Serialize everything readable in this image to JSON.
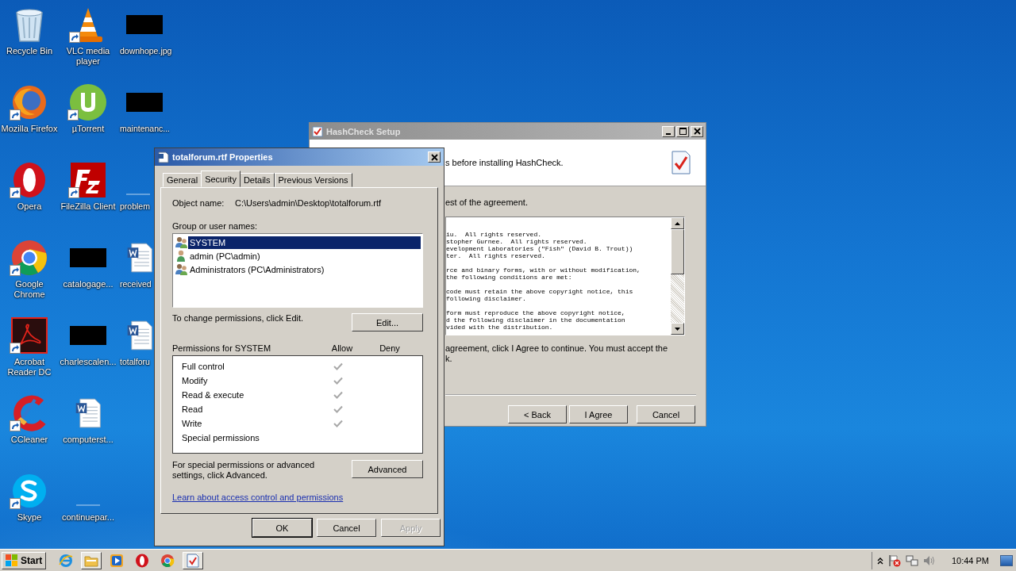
{
  "desktop_columns": [
    [
      {
        "label": "Recycle Bin",
        "kind": "recycle",
        "shortcut": false
      },
      {
        "label": "Mozilla Firefox",
        "kind": "firefox",
        "shortcut": true
      },
      {
        "label": "Opera",
        "kind": "opera",
        "shortcut": true
      },
      {
        "label": "Google Chrome",
        "kind": "chrome",
        "shortcut": true
      },
      {
        "label": "Acrobat Reader DC",
        "kind": "acrobat",
        "shortcut": true
      },
      {
        "label": "CCleaner",
        "kind": "ccleaner",
        "shortcut": true
      },
      {
        "label": "Skype",
        "kind": "skype",
        "shortcut": true
      }
    ],
    [
      {
        "label": "VLC media player",
        "kind": "vlc",
        "shortcut": true
      },
      {
        "label": "µTorrent",
        "kind": "utorrent",
        "shortcut": true
      },
      {
        "label": "FileZilla Client",
        "kind": "filezilla",
        "shortcut": true
      },
      {
        "label": "catalogage...",
        "kind": "redacted",
        "shortcut": false
      },
      {
        "label": "charlescalen...",
        "kind": "redacted",
        "shortcut": false
      },
      {
        "label": "computerst...",
        "kind": "word",
        "shortcut": false
      },
      {
        "label": "continuepar...",
        "kind": "blank",
        "shortcut": false
      }
    ],
    [
      {
        "label": "downhope.jpg",
        "kind": "redacted",
        "shortcut": false
      },
      {
        "label": "maintenanc...",
        "kind": "redacted",
        "shortcut": false
      },
      {
        "label": "problem",
        "kind": "blank",
        "shortcut": false
      },
      {
        "label": "received",
        "kind": "word",
        "shortcut": false
      },
      {
        "label": "totalforu",
        "kind": "word",
        "shortcut": false
      }
    ]
  ],
  "hashcheck_window": {
    "title": "HashCheck Setup",
    "header_text": "s before installing HashCheck.",
    "prompt": "est of the agreement.",
    "license_paragraphs": [
      [
        "iu.  All rights reserved.",
        "stopher Gurnee.  All rights reserved.",
        "evelopment Laboratories (\"Fish\" (David B. Trout))",
        "ter.  All rights reserved."
      ],
      [
        "rce and binary forms, with or without modification,",
        "the following conditions are met:"
      ],
      [
        "code must retain the above copyright notice, this",
        "following disclaimer."
      ],
      [
        "form must reproduce the above copyright notice,",
        "d the following disclaimer in the documentation",
        "vided with the distribution."
      ]
    ],
    "footer_lines": [
      "agreement, click I Agree to continue. You must accept the",
      "k."
    ],
    "buttons": [
      "< Back",
      "I Agree",
      "Cancel"
    ]
  },
  "properties_dialog": {
    "title": "totalforum.rtf Properties",
    "tabs": [
      {
        "label": "General",
        "selected": false
      },
      {
        "label": "Security",
        "selected": true
      },
      {
        "label": "Details",
        "selected": false
      },
      {
        "label": "Previous Versions",
        "selected": false
      }
    ],
    "object_name_label": "Object name:",
    "object_name": "C:\\Users\\admin\\Desktop\\totalforum.rtf",
    "group_label": "Group or user names:",
    "users": [
      {
        "name": "SYSTEM",
        "kind": "group",
        "selected": true
      },
      {
        "name": "admin (PC\\admin)",
        "kind": "user",
        "selected": false
      },
      {
        "name": "Administrators (PC\\Administrators)",
        "kind": "group",
        "selected": false
      }
    ],
    "change_hint": "To change permissions, click Edit.",
    "edit_button": "Edit...",
    "permissions_label": "Permissions for SYSTEM",
    "allow_header": "Allow",
    "deny_header": "Deny",
    "permissions": [
      {
        "name": "Full control",
        "allow": true
      },
      {
        "name": "Modify",
        "allow": true
      },
      {
        "name": "Read & execute",
        "allow": true
      },
      {
        "name": "Read",
        "allow": true
      },
      {
        "name": "Write",
        "allow": true
      },
      {
        "name": "Special permissions",
        "allow": false
      }
    ],
    "advanced_hint": "For special permissions or advanced settings, click Advanced.",
    "advanced_button": "Advanced",
    "link": "Learn about access control and permissions",
    "buttons": [
      {
        "label": "OK",
        "disabled": false
      },
      {
        "label": "Cancel",
        "disabled": false
      },
      {
        "label": "Apply",
        "disabled": true
      }
    ]
  },
  "taskbar": {
    "start_label": "Start",
    "apps": [
      {
        "kind": "ie",
        "selected": false
      },
      {
        "kind": "explorer",
        "selected": true
      },
      {
        "kind": "media",
        "selected": false
      },
      {
        "kind": "opera",
        "selected": false
      },
      {
        "kind": "chrome",
        "selected": false
      },
      {
        "kind": "hashcheck",
        "selected": true
      }
    ],
    "clock": "10:44 PM"
  }
}
